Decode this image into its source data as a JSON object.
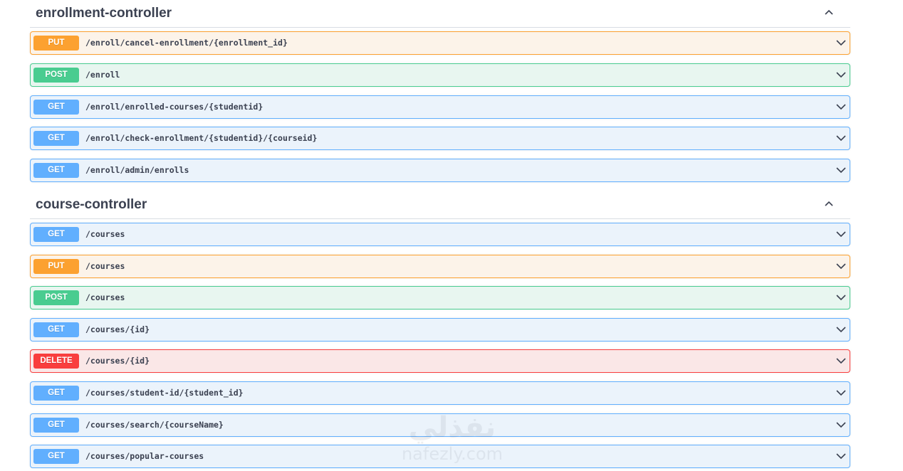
{
  "sections": [
    {
      "title": "enrollment-controller",
      "operations": [
        {
          "method": "PUT",
          "path": "/enroll/cancel-enrollment/{enrollment_id}"
        },
        {
          "method": "POST",
          "path": "/enroll"
        },
        {
          "method": "GET",
          "path": "/enroll/enrolled-courses/{studentid}"
        },
        {
          "method": "GET",
          "path": "/enroll/check-enrollment/{studentid}/{courseid}"
        },
        {
          "method": "GET",
          "path": "/enroll/admin/enrolls"
        }
      ]
    },
    {
      "title": "course-controller",
      "operations": [
        {
          "method": "GET",
          "path": "/courses"
        },
        {
          "method": "PUT",
          "path": "/courses"
        },
        {
          "method": "POST",
          "path": "/courses"
        },
        {
          "method": "GET",
          "path": "/courses/{id}"
        },
        {
          "method": "DELETE",
          "path": "/courses/{id}"
        },
        {
          "method": "GET",
          "path": "/courses/student-id/{student_id}"
        },
        {
          "method": "GET",
          "path": "/courses/search/{courseName}"
        },
        {
          "method": "GET",
          "path": "/courses/popular-courses"
        }
      ]
    }
  ],
  "watermark": {
    "arabic": "نفذلي",
    "latin": "nafezly.com"
  },
  "colors": {
    "get": "#61affe",
    "post": "#49cc90",
    "put": "#fca130",
    "delete": "#f93e3e",
    "text": "#3b4151"
  },
  "icons": {
    "section_toggle": "chevron-up-icon",
    "operation_toggle": "chevron-down-icon"
  }
}
